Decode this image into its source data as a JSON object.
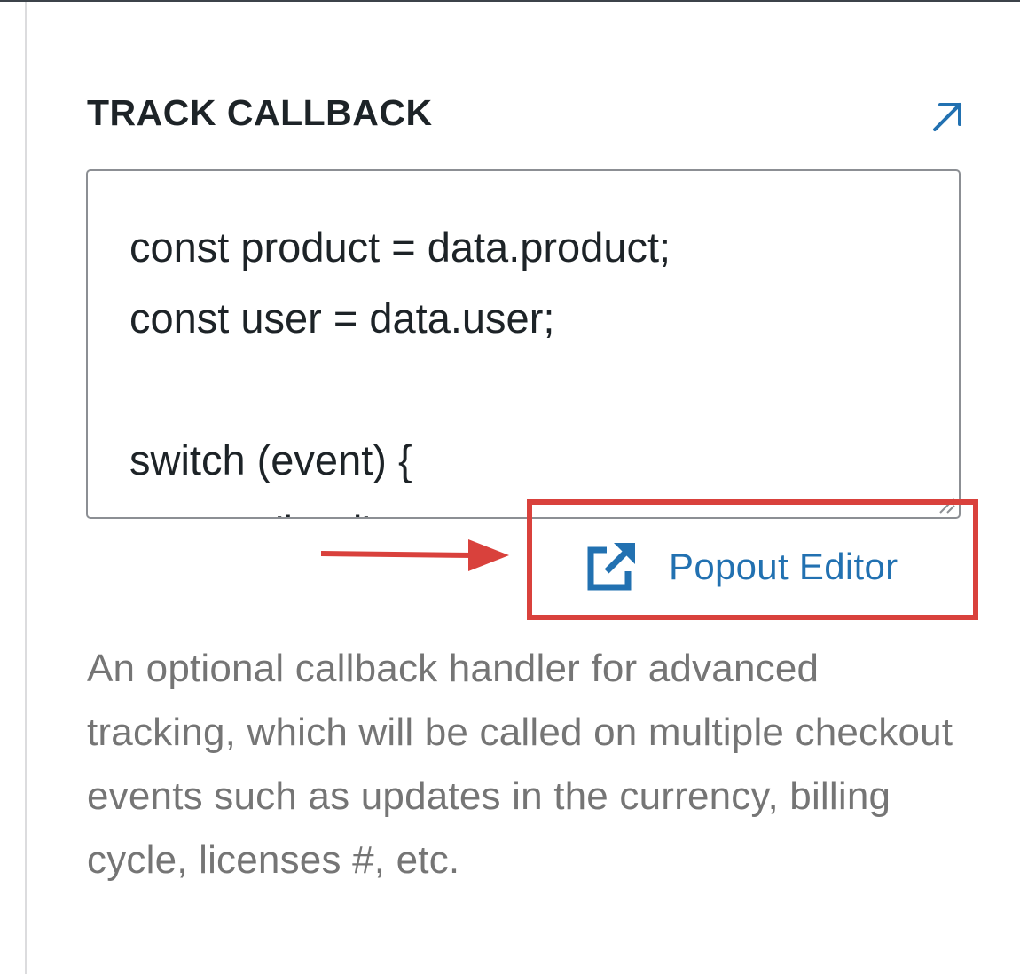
{
  "section": {
    "title": "TRACK CALLBACK"
  },
  "code_editor": {
    "lines": "const product = data.product;\nconst user = data.user;\n\nswitch (event) {\n    case 'load':"
  },
  "popout": {
    "label": "Popout Editor"
  },
  "description": {
    "text": "An optional callback handler for advanced tracking, which will be called on multiple checkout events such as updates in the currency, billing cycle, licenses #, etc."
  },
  "colors": {
    "accent": "#2271b1",
    "annotation": "#d9413c",
    "muted_text": "#757575"
  },
  "icons": {
    "expand": "arrow-up-right-icon",
    "popout": "external-link-icon"
  }
}
